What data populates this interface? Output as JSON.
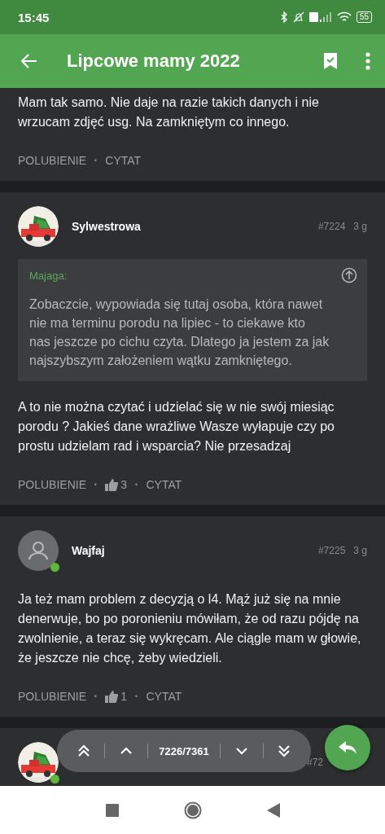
{
  "status_bar": {
    "time": "15:45",
    "battery": "55"
  },
  "app_bar": {
    "title": "Lipcowe mamy 2022"
  },
  "posts": [
    {
      "kind": "continued",
      "text": "Mam tak samo. Nie daje na razie takich danych i nie wrzucam zdjęć usg. Na zamkniętym co innego.",
      "like_label": "POLUBIENIE",
      "dot": "·",
      "quote_label": "CYTAT"
    },
    {
      "kind": "full",
      "online": false,
      "author": "Sylwestrowa",
      "number": "#7224",
      "age": "3 g",
      "quote": {
        "author": "Majaga:",
        "text": "Zobaczcie, wypowiada się tutaj osoba, która nawet nie ma terminu porodu na lipiec - to ciekawe kto nas jeszcze po cichu czyta. Dlatego ja jestem za jak najszybszym założeniem wątku zamkniętego."
      },
      "text": "A to nie można czytać i udzielać się w nie swój miesiąc porodu ? Jakieś dane wrażliwe Wasze wyłapuje czy po prostu udzielam rad i wsparcia? Nie przesadzaj",
      "like_label": "POLUBIENIE",
      "dot": "·",
      "like_count": "3",
      "quote_label": "CYTAT"
    },
    {
      "kind": "full",
      "avatar": {
        "kind": "default"
      },
      "online": true,
      "author": "Wajfaj",
      "number": "#7225",
      "age": "3 g",
      "text": "Ja też mam problem z decyzją o l4. Mąż już się na mnie denerwuje, bo po poronieniu mówiłam, że od razu pójdę na zwolnienie, a teraz się wykręcam. Ale ciągle mam w głowie, że jeszcze nie chcę, żeby wiedzieli.",
      "like_label": "POLUBIENIE",
      "dot": "·",
      "like_count": "1",
      "quote_label": "CYTAT"
    },
    {
      "kind": "cutoff",
      "online": true,
      "number": "#72"
    }
  ],
  "navigator": {
    "counter": "7226/7361"
  }
}
